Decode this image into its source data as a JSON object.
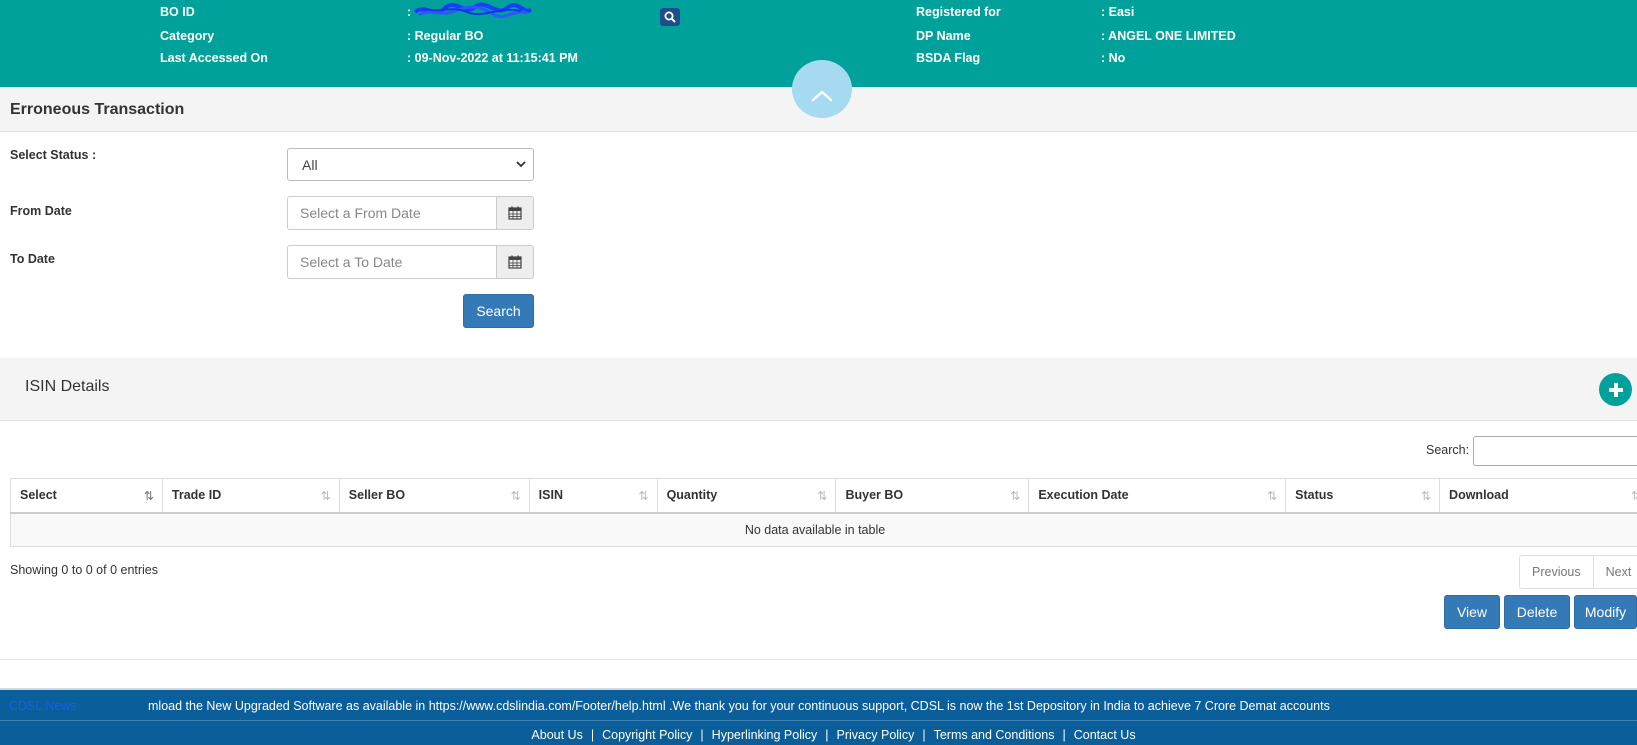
{
  "header": {
    "bo_id_label": "BO ID",
    "bo_id_value": ":",
    "category_label": "Category",
    "category_value": ": Regular BO",
    "last_accessed_label": "Last Accessed On",
    "last_accessed_value": ": 09-Nov-2022 at 11:15:41 PM",
    "registered_for_label": "Registered for",
    "registered_for_value": ": Easi",
    "dp_name_label": "DP Name",
    "dp_name_value": ": ANGEL ONE LIMITED",
    "bsda_label": "BSDA Flag",
    "bsda_value": ": No",
    "colors": {
      "bar": "#00a19a",
      "search_button": "#1f4f8a",
      "collapse": "#a5daf0"
    },
    "icons": [
      "search-icon",
      "chevron-up-icon"
    ]
  },
  "erroneous": {
    "title": "Erroneous Transaction",
    "status_label": "Select Status :",
    "status_value": "All",
    "from_label": "From Date",
    "from_placeholder": "Select a From Date",
    "to_label": "To Date",
    "to_placeholder": "Select a To Date",
    "search_button": "Search"
  },
  "isin": {
    "title": "ISIN Details",
    "search_label": "Search:",
    "columns": [
      "Select",
      "Trade ID",
      "Seller BO",
      "ISIN",
      "Quantity",
      "Buyer BO",
      "Execution Date",
      "Status",
      "Download"
    ],
    "empty_message": "No data available in table",
    "showing": "Showing 0 to 0 of 0 entries",
    "previous": "Previous",
    "next": "Next",
    "actions": {
      "view": "View",
      "delete": "Delete",
      "modify": "Modify"
    },
    "colors": {
      "accent": "#00a19a",
      "button": "#337ab7"
    }
  },
  "footer": {
    "news_label": "CDSL News",
    "news_text": "mload the New Upgraded Software as available in https://www.cdslindia.com/Footer/help.html .We thank you for your continuous support, CDSL is now the 1st Depository in India to achieve 7 Crore Demat accounts",
    "links": [
      "About Us",
      "Copyright Policy",
      "Hyperlinking Policy",
      "Privacy Policy",
      "Terms and Conditions",
      "Contact Us"
    ],
    "colors": {
      "bar": "#0a5e9a"
    }
  }
}
